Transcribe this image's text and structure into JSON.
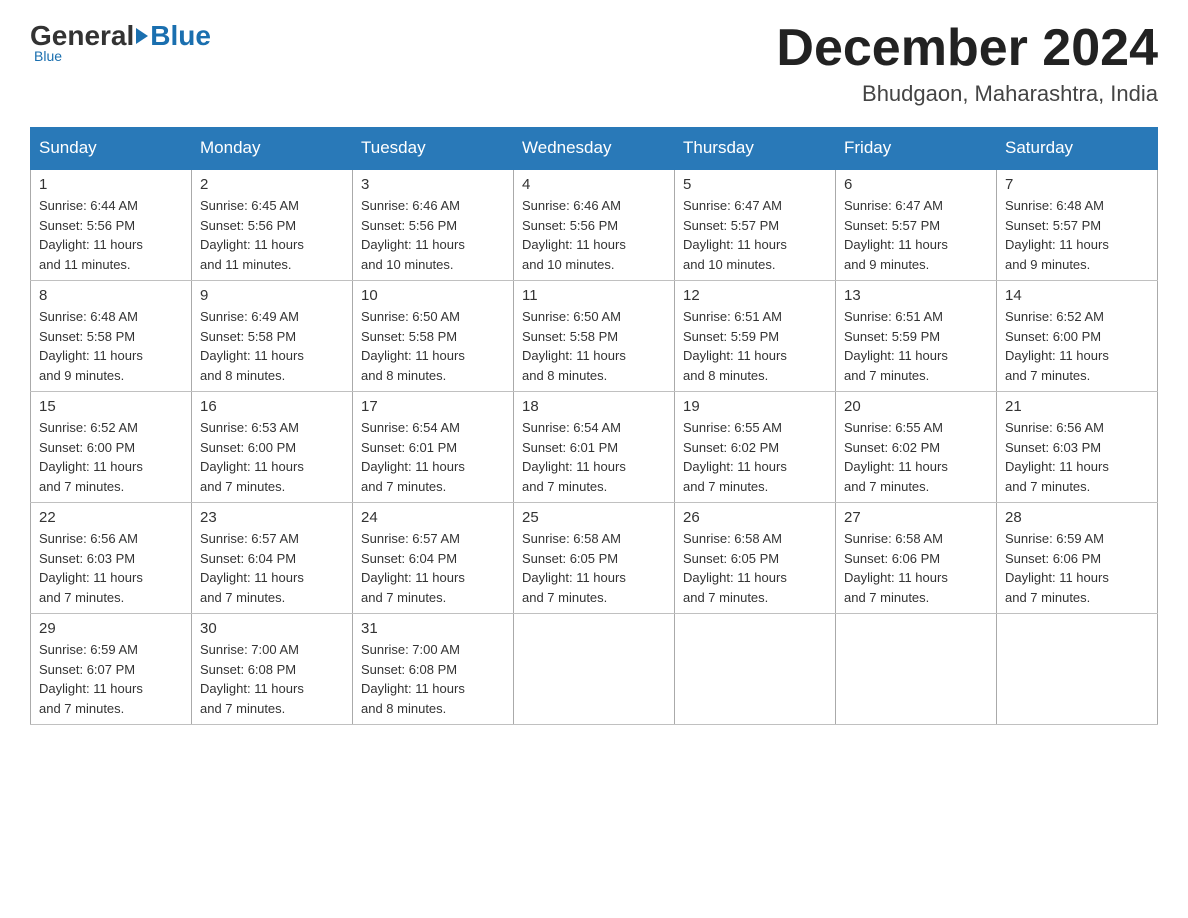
{
  "header": {
    "logo": {
      "general": "General",
      "blue": "Blue",
      "subtitle": "Blue"
    },
    "title": "December 2024",
    "location": "Bhudgaon, Maharashtra, India"
  },
  "days_of_week": [
    "Sunday",
    "Monday",
    "Tuesday",
    "Wednesday",
    "Thursday",
    "Friday",
    "Saturday"
  ],
  "weeks": [
    [
      {
        "day": "1",
        "sunrise": "6:44 AM",
        "sunset": "5:56 PM",
        "daylight": "11 hours and 11 minutes."
      },
      {
        "day": "2",
        "sunrise": "6:45 AM",
        "sunset": "5:56 PM",
        "daylight": "11 hours and 11 minutes."
      },
      {
        "day": "3",
        "sunrise": "6:46 AM",
        "sunset": "5:56 PM",
        "daylight": "11 hours and 10 minutes."
      },
      {
        "day": "4",
        "sunrise": "6:46 AM",
        "sunset": "5:56 PM",
        "daylight": "11 hours and 10 minutes."
      },
      {
        "day": "5",
        "sunrise": "6:47 AM",
        "sunset": "5:57 PM",
        "daylight": "11 hours and 10 minutes."
      },
      {
        "day": "6",
        "sunrise": "6:47 AM",
        "sunset": "5:57 PM",
        "daylight": "11 hours and 9 minutes."
      },
      {
        "day": "7",
        "sunrise": "6:48 AM",
        "sunset": "5:57 PM",
        "daylight": "11 hours and 9 minutes."
      }
    ],
    [
      {
        "day": "8",
        "sunrise": "6:48 AM",
        "sunset": "5:58 PM",
        "daylight": "11 hours and 9 minutes."
      },
      {
        "day": "9",
        "sunrise": "6:49 AM",
        "sunset": "5:58 PM",
        "daylight": "11 hours and 8 minutes."
      },
      {
        "day": "10",
        "sunrise": "6:50 AM",
        "sunset": "5:58 PM",
        "daylight": "11 hours and 8 minutes."
      },
      {
        "day": "11",
        "sunrise": "6:50 AM",
        "sunset": "5:58 PM",
        "daylight": "11 hours and 8 minutes."
      },
      {
        "day": "12",
        "sunrise": "6:51 AM",
        "sunset": "5:59 PM",
        "daylight": "11 hours and 8 minutes."
      },
      {
        "day": "13",
        "sunrise": "6:51 AM",
        "sunset": "5:59 PM",
        "daylight": "11 hours and 7 minutes."
      },
      {
        "day": "14",
        "sunrise": "6:52 AM",
        "sunset": "6:00 PM",
        "daylight": "11 hours and 7 minutes."
      }
    ],
    [
      {
        "day": "15",
        "sunrise": "6:52 AM",
        "sunset": "6:00 PM",
        "daylight": "11 hours and 7 minutes."
      },
      {
        "day": "16",
        "sunrise": "6:53 AM",
        "sunset": "6:00 PM",
        "daylight": "11 hours and 7 minutes."
      },
      {
        "day": "17",
        "sunrise": "6:54 AM",
        "sunset": "6:01 PM",
        "daylight": "11 hours and 7 minutes."
      },
      {
        "day": "18",
        "sunrise": "6:54 AM",
        "sunset": "6:01 PM",
        "daylight": "11 hours and 7 minutes."
      },
      {
        "day": "19",
        "sunrise": "6:55 AM",
        "sunset": "6:02 PM",
        "daylight": "11 hours and 7 minutes."
      },
      {
        "day": "20",
        "sunrise": "6:55 AM",
        "sunset": "6:02 PM",
        "daylight": "11 hours and 7 minutes."
      },
      {
        "day": "21",
        "sunrise": "6:56 AM",
        "sunset": "6:03 PM",
        "daylight": "11 hours and 7 minutes."
      }
    ],
    [
      {
        "day": "22",
        "sunrise": "6:56 AM",
        "sunset": "6:03 PM",
        "daylight": "11 hours and 7 minutes."
      },
      {
        "day": "23",
        "sunrise": "6:57 AM",
        "sunset": "6:04 PM",
        "daylight": "11 hours and 7 minutes."
      },
      {
        "day": "24",
        "sunrise": "6:57 AM",
        "sunset": "6:04 PM",
        "daylight": "11 hours and 7 minutes."
      },
      {
        "day": "25",
        "sunrise": "6:58 AM",
        "sunset": "6:05 PM",
        "daylight": "11 hours and 7 minutes."
      },
      {
        "day": "26",
        "sunrise": "6:58 AM",
        "sunset": "6:05 PM",
        "daylight": "11 hours and 7 minutes."
      },
      {
        "day": "27",
        "sunrise": "6:58 AM",
        "sunset": "6:06 PM",
        "daylight": "11 hours and 7 minutes."
      },
      {
        "day": "28",
        "sunrise": "6:59 AM",
        "sunset": "6:06 PM",
        "daylight": "11 hours and 7 minutes."
      }
    ],
    [
      {
        "day": "29",
        "sunrise": "6:59 AM",
        "sunset": "6:07 PM",
        "daylight": "11 hours and 7 minutes."
      },
      {
        "day": "30",
        "sunrise": "7:00 AM",
        "sunset": "6:08 PM",
        "daylight": "11 hours and 7 minutes."
      },
      {
        "day": "31",
        "sunrise": "7:00 AM",
        "sunset": "6:08 PM",
        "daylight": "11 hours and 8 minutes."
      },
      null,
      null,
      null,
      null
    ]
  ],
  "labels": {
    "sunrise": "Sunrise:",
    "sunset": "Sunset:",
    "daylight": "Daylight:"
  }
}
